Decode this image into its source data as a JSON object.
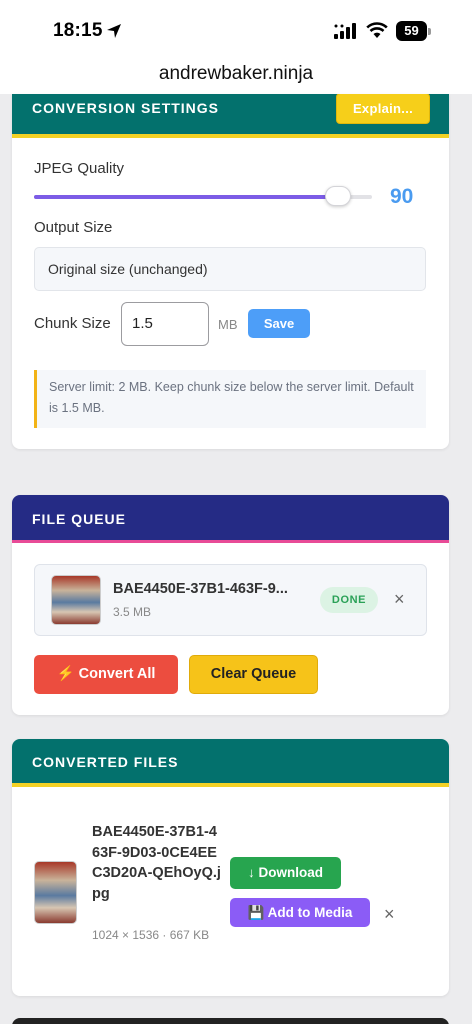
{
  "status_bar": {
    "time": "18:15",
    "battery": "59"
  },
  "url": "andrewbaker.ninja",
  "settings": {
    "title": "CONVERSION SETTINGS",
    "explain_label": "Explain...",
    "jpeg_quality_label": "JPEG Quality",
    "jpeg_quality_value": "90",
    "jpeg_quality_fraction": 0.9,
    "output_size_label": "Output Size",
    "output_size_value": "Original size (unchanged)",
    "chunk_size_label": "Chunk Size",
    "chunk_size_value": "1.5",
    "chunk_unit": "MB",
    "save_label": "Save",
    "info_text": "Server limit: 2 MB. Keep chunk size below the server limit. Default is 1.5 MB."
  },
  "queue": {
    "title": "FILE QUEUE",
    "file_name": "BAE4450E-37B1-463F-9...",
    "file_size": "3.5 MB",
    "status": "DONE",
    "remove_glyph": "×",
    "convert_all_label": "⚡ Convert All",
    "clear_label": "Clear Queue"
  },
  "converted": {
    "title": "CONVERTED FILES",
    "file_name": "BAE4450E-37B1-463F-9D03-0CE4EEC3D20A-QEhOyQ.jpg",
    "meta": "1024 × 1536 · 667 KB",
    "download_label": "↓ Download",
    "add_media_label": "💾 Add to Media",
    "remove_glyph": "×"
  },
  "colors": {
    "teal_header": "#03716d",
    "navy_header": "#252b85",
    "accent_yellow": "#f3d125",
    "slider_purple": "#7c5ce6",
    "value_blue": "#4a9bf0"
  }
}
